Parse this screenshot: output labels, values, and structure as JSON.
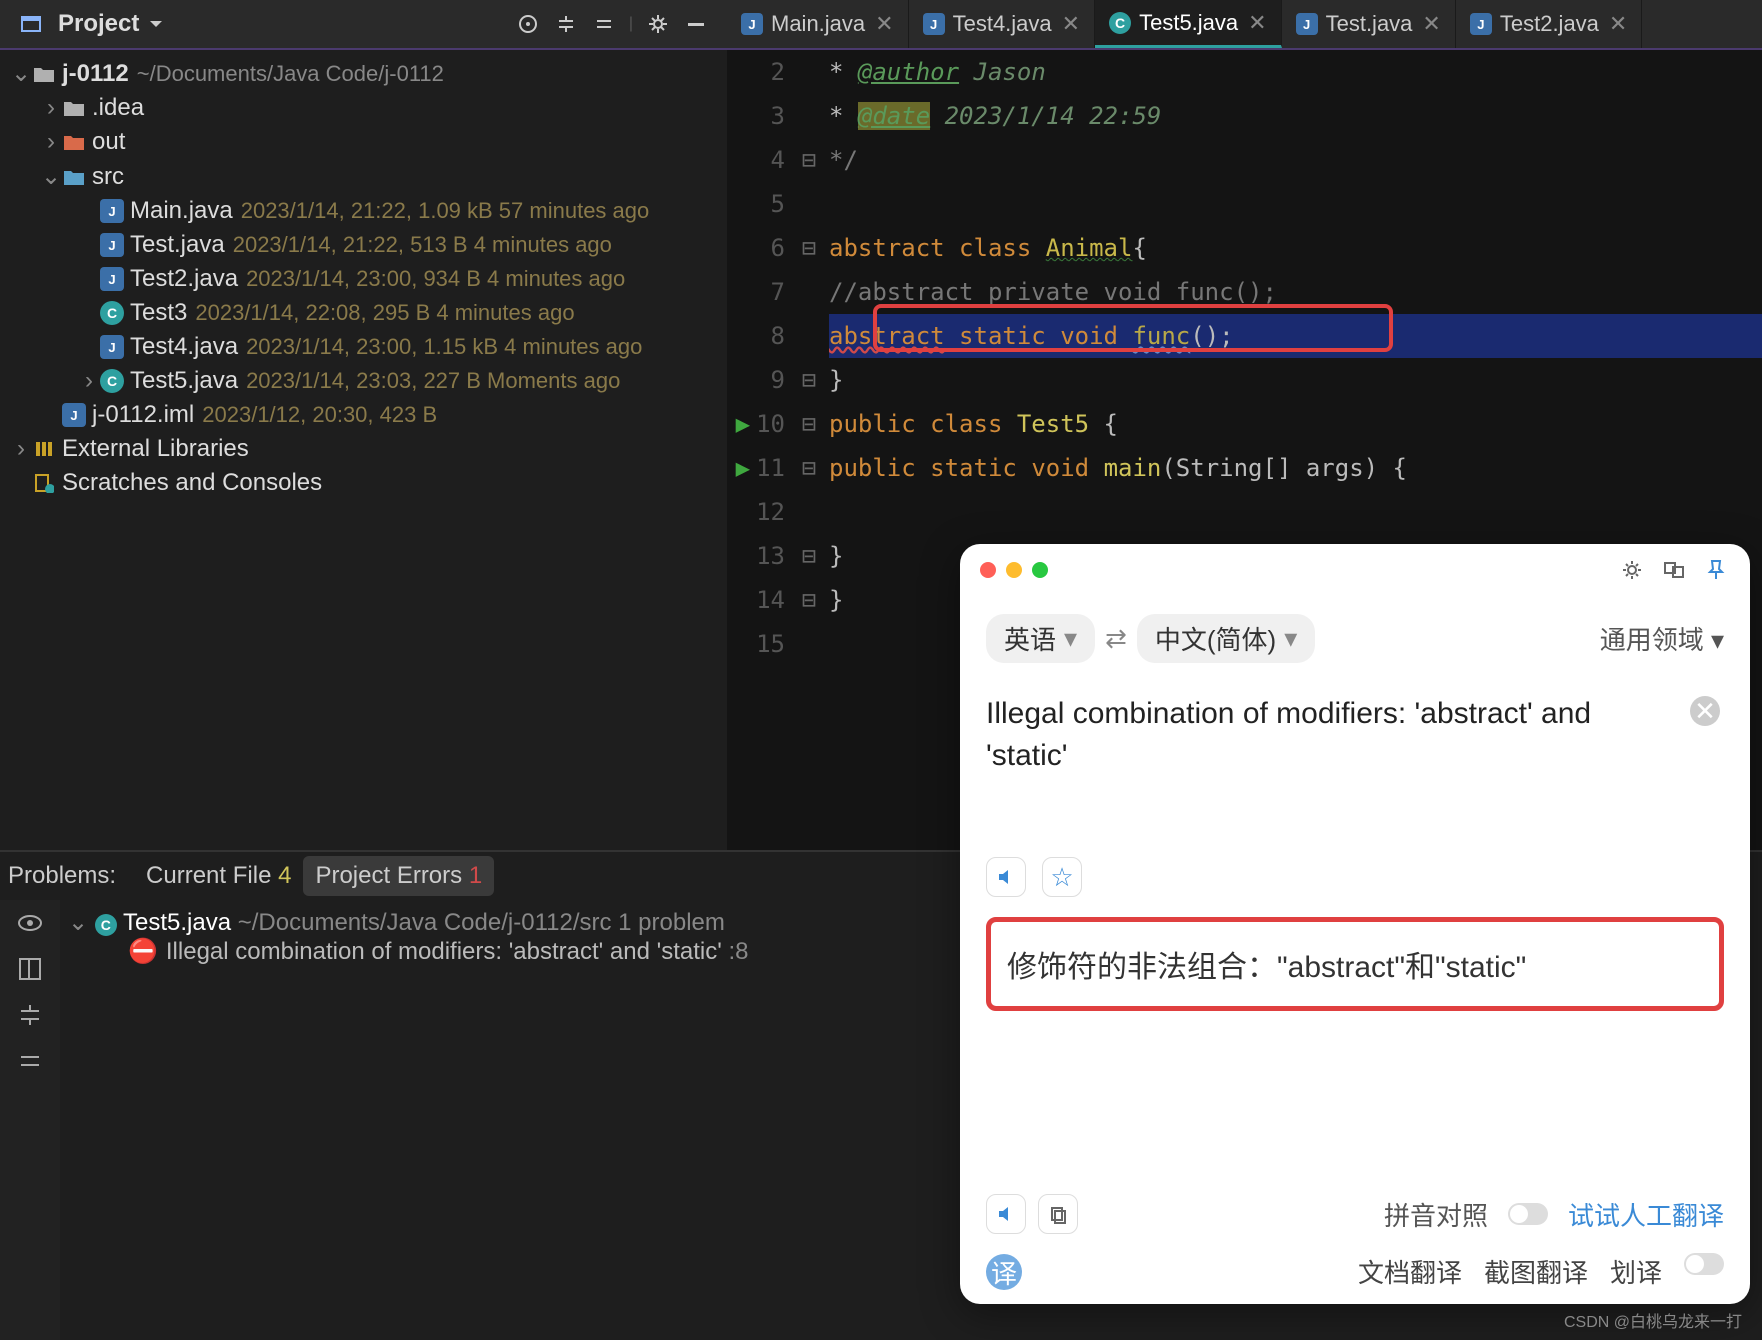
{
  "toolbar": {
    "title": "Project"
  },
  "project": {
    "root": {
      "name": "j-0112",
      "path": "~/Documents/Java Code/j-0112"
    },
    "folders": [
      {
        "name": ".idea",
        "kind": "dark"
      },
      {
        "name": "out",
        "kind": "red"
      },
      {
        "name": "src",
        "kind": "blue",
        "expanded": true
      }
    ],
    "src_files": [
      {
        "name": "Main.java",
        "icon": "java",
        "meta": "2023/1/14, 21:22, 1.09 kB 57 minutes ago"
      },
      {
        "name": "Test.java",
        "icon": "java",
        "meta": "2023/1/14, 21:22, 513 B 4 minutes ago"
      },
      {
        "name": "Test2.java",
        "icon": "java",
        "meta": "2023/1/14, 23:00, 934 B 4 minutes ago"
      },
      {
        "name": "Test3",
        "icon": "class",
        "meta": "2023/1/14, 22:08, 295 B 4 minutes ago"
      },
      {
        "name": "Test4.java",
        "icon": "java",
        "meta": "2023/1/14, 23:00, 1.15 kB 4 minutes ago"
      },
      {
        "name": "Test5.java",
        "icon": "class",
        "meta": "2023/1/14, 23:03, 227 B Moments ago",
        "expandable": true
      }
    ],
    "iml": {
      "name": "j-0112.iml",
      "meta": "2023/1/12, 20:30, 423 B"
    },
    "ext_libs": "External Libraries",
    "scratches": "Scratches and Consoles"
  },
  "tabs": [
    {
      "label": "Main.java",
      "icon": "java"
    },
    {
      "label": "Test4.java",
      "icon": "java"
    },
    {
      "label": "Test5.java",
      "icon": "class",
      "active": true
    },
    {
      "label": "Test.java",
      "icon": "java"
    },
    {
      "label": "Test2.java",
      "icon": "java"
    }
  ],
  "code": {
    "lines": [
      {
        "n": 2,
        "html": " * <span class='c-ann'>@author</span> <span class='c-annval'>Jason</span>"
      },
      {
        "n": 3,
        "html": " * <span class='c-ann hl-ann'>@date</span> <span class='c-annval'>2023/1/14 22:59</span>"
      },
      {
        "n": 4,
        "html": " */",
        "cls": "c-comm"
      },
      {
        "n": 5,
        "html": ""
      },
      {
        "n": 6,
        "html": "<span class='c-key'>abstract</span>  <span class='c-key'>class</span> <span class='c-cls'>Animal</span>{"
      },
      {
        "n": 7,
        "html": "    <span class='c-comm'>//abstract  private  void func();</span>"
      },
      {
        "n": 8,
        "html": "    <span class='c-key' style='text-decoration:underline wavy #d04a4a'>abstract</span>   <span class='c-key'>static</span> <span class='c-key'>void</span> <span class='c-meth' style='text-decoration:underline wavy #6a8ac8'>func</span>();",
        "sel": true
      },
      {
        "n": 9,
        "html": "}"
      },
      {
        "n": 10,
        "html": "<span class='c-key'>public</span> <span class='c-key'>class</span> <span class='c-func'>Test5</span> {",
        "run": true
      },
      {
        "n": 11,
        "html": "    <span class='c-key'>public</span> <span class='c-key'>static</span> <span class='c-key'>void</span> <span class='c-func'>main</span>(String[] args) {",
        "run": true
      },
      {
        "n": 12,
        "html": ""
      },
      {
        "n": 13,
        "html": "    }"
      },
      {
        "n": 14,
        "html": "}"
      },
      {
        "n": 15,
        "html": ""
      }
    ]
  },
  "problems": {
    "header": "Problems:",
    "tabs": [
      {
        "label": "Current File",
        "count": "4",
        "countcls": "cnt1"
      },
      {
        "label": "Project Errors",
        "count": "1",
        "countcls": "cnt2",
        "active": true
      }
    ],
    "file": "Test5.java",
    "path": "~/Documents/Java Code/j-0112/src",
    "pcount": "1 problem",
    "error": "Illegal combination of modifiers: 'abstract' and 'static'",
    "loc": ":8"
  },
  "popup": {
    "from": "英语",
    "to": "中文(简体)",
    "domain": "通用领域",
    "src": "Illegal combination of modifiers: 'abstract' and 'static'",
    "dst": "修饰符的非法组合：\"abstract\"和\"static\"",
    "pinyin": "拼音对照",
    "try": "试试人工翻译",
    "doc": "文档翻译",
    "screen": "截图翻译",
    "scribe": "划译"
  },
  "watermark": "CSDN @白桃乌龙来一打"
}
